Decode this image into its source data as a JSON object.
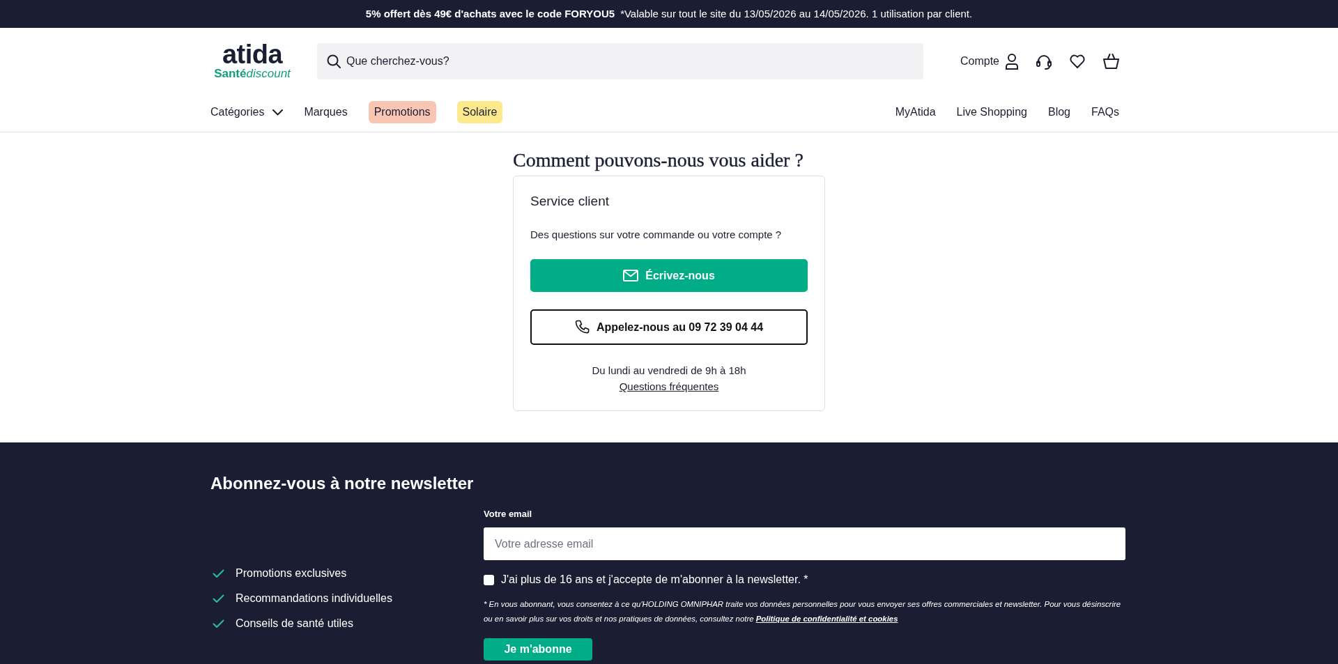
{
  "promo_bar": {
    "offer": "5% offert dès 49€ d'achats avec le code FORYOU5",
    "conditions": "*Valable sur tout le site du 13/05/2026 au 14/05/2026. 1 utilisation par client."
  },
  "header": {
    "logo": {
      "wordmark": "atida",
      "tagline_bold": "Santé",
      "tagline_italic": "discount"
    },
    "search": {
      "placeholder": "Que cherchez-vous?"
    },
    "account": {
      "label": "Compte"
    }
  },
  "nav": {
    "left": [
      {
        "label": "Catégories",
        "kind": "dropdown"
      },
      {
        "label": "Marques",
        "kind": "link"
      },
      {
        "label": "Promotions",
        "kind": "link",
        "color": "#f9c6b4"
      },
      {
        "label": "Solaire",
        "kind": "link",
        "color": "#fce98c"
      }
    ],
    "right": [
      "MyAtida",
      "Live Shopping",
      "Blog",
      "FAQs"
    ]
  },
  "help": {
    "title": "Comment pouvons-nous vous aider ?",
    "card": {
      "title": "Service client",
      "question": "Des questions sur votre commande ou votre compte ?",
      "buttons": [
        {
          "label": "Écrivez-nous",
          "kind": "primary"
        },
        {
          "label": "Appelez-nous au 09 72 39 04 44",
          "kind": "outline"
        }
      ],
      "hours": "Du lundi au vendredi de 9h à 18h",
      "faq_link": "Questions fréquentes"
    }
  },
  "newsletter": {
    "title": "Abonnez-vous à notre newsletter",
    "benefits": [
      "Promotions exclusives",
      "Recommandations individuelles",
      "Conseils de santé utiles"
    ],
    "email_label": "Votre email",
    "email": {
      "placeholder": "Votre adresse email"
    },
    "consent": {
      "label": "J'ai plus de 16 ans et j'accepte de m'abonner à la newsletter. *",
      "checked": false
    },
    "notice": "* En vous abonnant, vous consentez à ce qu'HOLDING OMNIPHAR traite vos données personnelles pour vous envoyer ses offres commerciales et newsletter. Pour vous désinscrire ou en savoir plus sur vos droits et nos pratiques de données, consultez notre",
    "privacy_link": "Politique de confidentialité et cookies",
    "submit": "Je m'abonne"
  }
}
